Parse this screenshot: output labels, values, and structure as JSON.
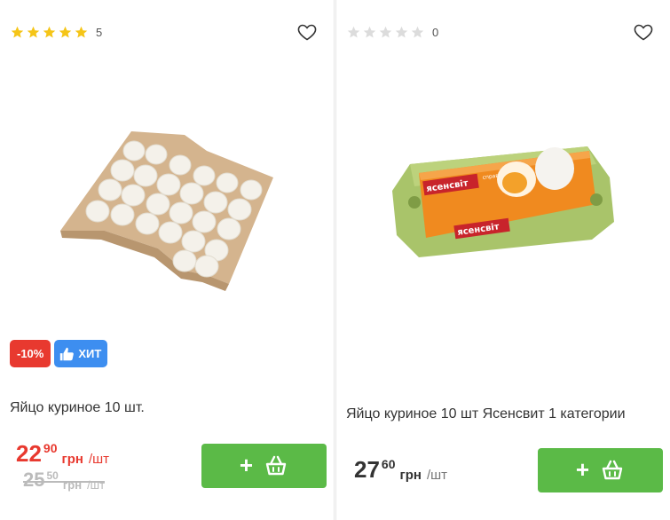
{
  "products": [
    {
      "rating_count": "5",
      "rating_value": 5,
      "badges": {
        "sale": "-10%",
        "hit": "ХИТ"
      },
      "title": "Яйцо куриное 10 шт.",
      "price": {
        "int": "22",
        "dec": "90",
        "currency": "грн",
        "unit": "/шт"
      },
      "old_price": {
        "int": "25",
        "dec": "50",
        "currency": "грн",
        "unit": "/шт"
      },
      "cart_plus": "+"
    },
    {
      "rating_count": "0",
      "rating_value": 0,
      "title": "Яйцо куриное 10 шт Ясенсвит 1 категории",
      "price": {
        "int": "27",
        "dec": "60",
        "currency": "грн",
        "unit": "/шт"
      },
      "cart_plus": "+",
      "package_brand": "ясенсвіт",
      "package_sub": "справжні курячі"
    }
  ],
  "colors": {
    "accent": "#5bba47",
    "sale": "#e8392f",
    "hit": "#3d8ef0",
    "star_on": "#f5c518",
    "star_off": "#dcdcdc"
  }
}
